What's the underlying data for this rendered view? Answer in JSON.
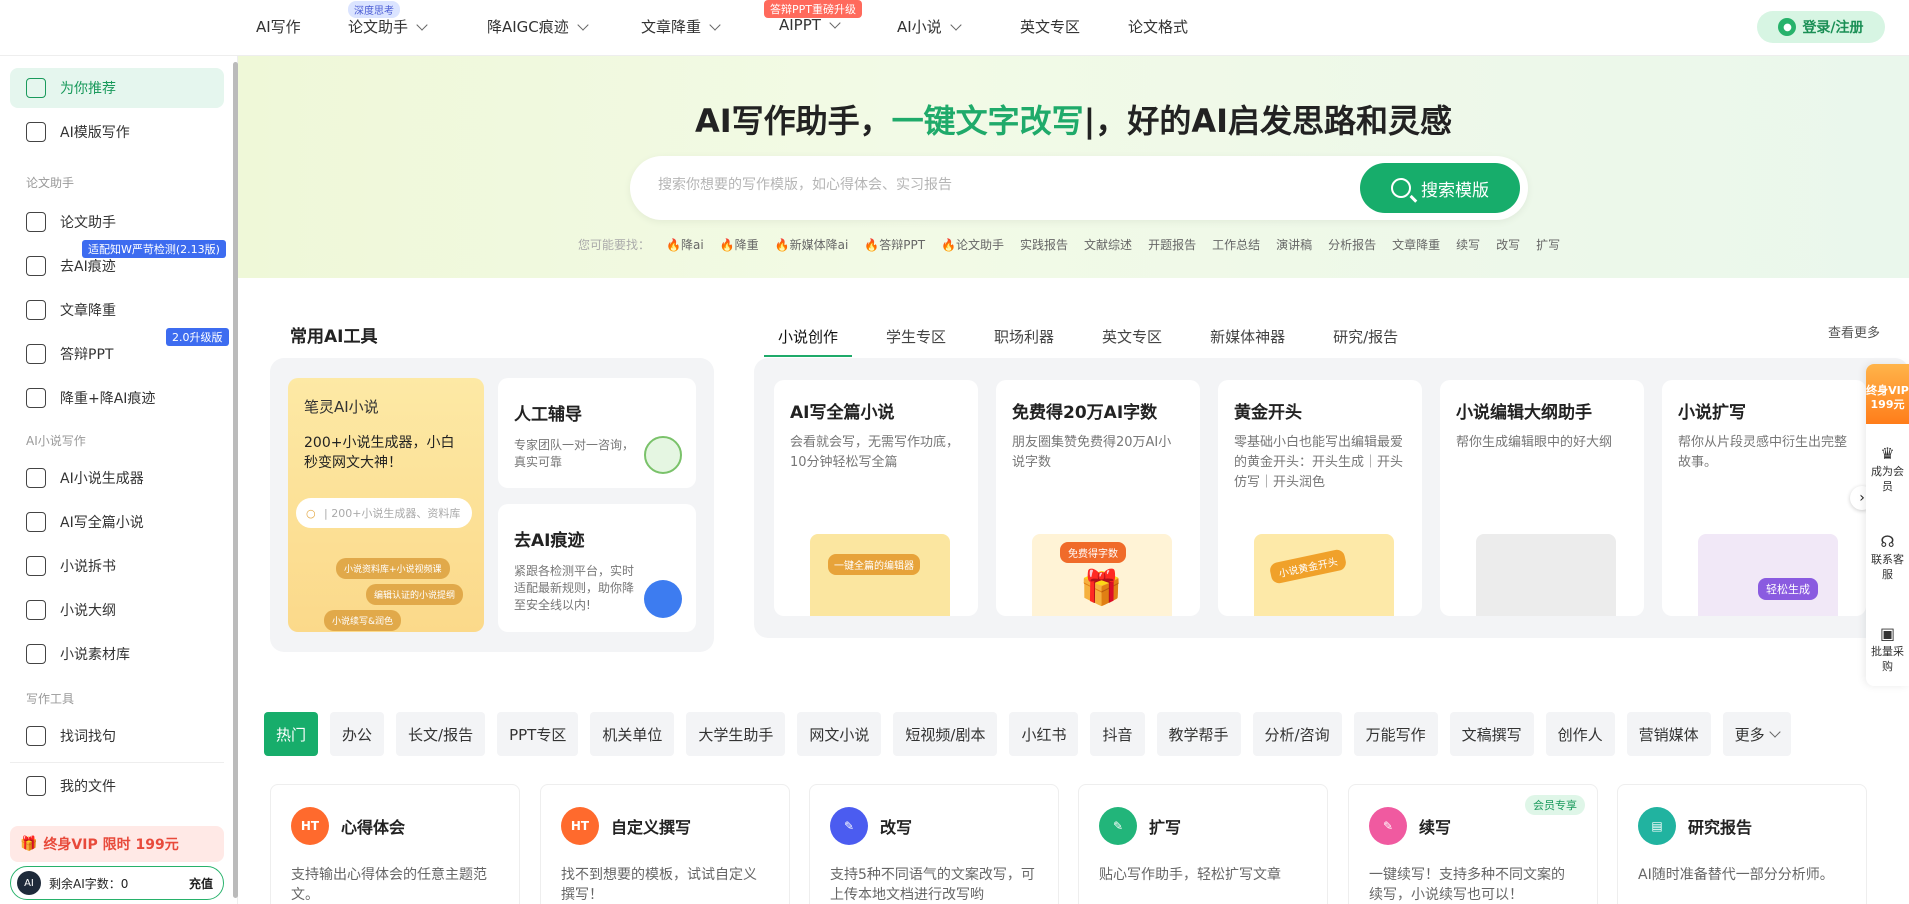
{
  "nav": {
    "items": [
      {
        "label": "AI写作"
      },
      {
        "label": "论文助手",
        "tag": "深度思考"
      },
      {
        "label": "降AIGC痕迹"
      },
      {
        "label": "文章降重"
      },
      {
        "label": "AIPPT",
        "tag": "答辩PPT重磅升级"
      },
      {
        "label": "AI小说"
      },
      {
        "label": "英文专区"
      },
      {
        "label": "论文格式"
      }
    ],
    "login": "登录/注册"
  },
  "sidebar": {
    "items": [
      {
        "label": "为你推荐"
      },
      {
        "label": "AI模版写作"
      }
    ],
    "section_thesis": "论文助手",
    "thesis_items": [
      {
        "label": "论文助手"
      },
      {
        "label": "去AI痕迹"
      },
      {
        "label": "文章降重"
      },
      {
        "label": "答辩PPT"
      },
      {
        "label": "降重+降AI痕迹"
      }
    ],
    "badge_aigc": "适配知W严苛检测(2.13版)",
    "badge_ppt": "2.0升级版",
    "section_novel": "AI小说写作",
    "novel_items": [
      {
        "label": "AI小说生成器"
      },
      {
        "label": "AI写全篇小说"
      },
      {
        "label": "小说拆书"
      },
      {
        "label": "小说大纲"
      },
      {
        "label": "小说素材库"
      }
    ],
    "section_tools": "写作工具",
    "tool_items": [
      {
        "label": "找词找句"
      },
      {
        "label": "我的文件"
      }
    ],
    "vip": "终身VIP 限时 199元",
    "count_label": "剩余AI字数：0",
    "recharge": "充值"
  },
  "hero": {
    "title_a": "AI写作助手，",
    "title_b": "一键文字改写",
    "title_c": "|，好的AI启发思路和灵感",
    "placeholder": "搜索你想要的写作模版，如心得体会、实习报告",
    "search_btn": "搜索模版",
    "suggest_label": "您可能要找：",
    "suggest": [
      "降ai",
      "降重",
      "新媒体降ai",
      "答辩PPT",
      "论文助手",
      "实践报告",
      "文献综述",
      "开题报告",
      "工作总结",
      "演讲稿",
      "分析报告",
      "文章降重",
      "续写",
      "改写",
      "扩写"
    ]
  },
  "tools": {
    "title": "常用AI工具",
    "novel_title": "笔灵AI小说",
    "novel_desc": "200+小说生成器，小白秒变网文大神！",
    "mini_search": "| 200+小说生成器、资料库",
    "pills": [
      "小说资料库+小说视频课",
      "编辑认证的小说提纲",
      "小说续写&润色"
    ],
    "human_title": "人工辅导",
    "human_desc": "专家团队一对一咨询，真实可靠",
    "deai_title": "去AI痕迹",
    "deai_desc": "紧跟各检测平台，实时适配最新规则，助你降至安全线以内!"
  },
  "tabs": [
    "小说创作",
    "学生专区",
    "职场利器",
    "英文专区",
    "新媒体神器",
    "研究/报告"
  ],
  "see_more": "查看更多",
  "feature_cards": [
    {
      "title": "AI写全篇小说",
      "desc": "会看就会写，无需写作功底，10分钟轻松写全篇",
      "art": "一键全篇的编辑器"
    },
    {
      "title": "免费得20万AI字数",
      "desc": "朋友圈集赞免费得20万AI小说字数",
      "art": "免费得字数"
    },
    {
      "title": "黄金开头",
      "desc": "零基础小白也能写出编辑最爱的黄金开头：开头生成｜开头仿写｜开头润色",
      "art": "小说黄金开头"
    },
    {
      "title": "小说编辑大纲助手",
      "desc": "帮你生成编辑眼中的好大纲",
      "art": ""
    },
    {
      "title": "小说扩写",
      "desc": "帮你从片段灵感中衍生出完整故事。",
      "art": "轻松生成"
    }
  ],
  "float": {
    "vip": "终身VIP 199元",
    "member": "成为会员",
    "service": "联系客服",
    "bulk": "批量采购"
  },
  "categories": [
    "热门",
    "办公",
    "长文/报告",
    "PPT专区",
    "机关单位",
    "大学生助手",
    "网文小说",
    "短视频/剧本",
    "小红书",
    "抖音",
    "教学帮手",
    "分析/咨询",
    "万能写作",
    "文稿撰写",
    "创作人",
    "营销媒体",
    "更多"
  ],
  "bottom_cards": [
    {
      "title": "心得体会",
      "desc": "支持输出心得体会的任意主题范文。",
      "icon": "HT"
    },
    {
      "title": "自定义撰写",
      "desc": "找不到想要的模板，试试自定义撰写！",
      "icon": "HT"
    },
    {
      "title": "改写",
      "desc": "支持5种不同语气的文案改写，可上传本地文档进行改写哟",
      "icon": ""
    },
    {
      "title": "扩写",
      "desc": "贴心写作助手，轻松扩写文章",
      "icon": ""
    },
    {
      "title": "续写",
      "desc": "一键续写！支持多种不同文案的续写，小说续写也可以！",
      "icon": "",
      "tag": "会员专享"
    },
    {
      "title": "研究报告",
      "desc": "AI随时准备替代一部分分析师。",
      "icon": ""
    }
  ],
  "colors": {
    "accent": "#17ad6b",
    "badge_blue": "#3d6cf0",
    "vip_red": "#e84a3b"
  }
}
